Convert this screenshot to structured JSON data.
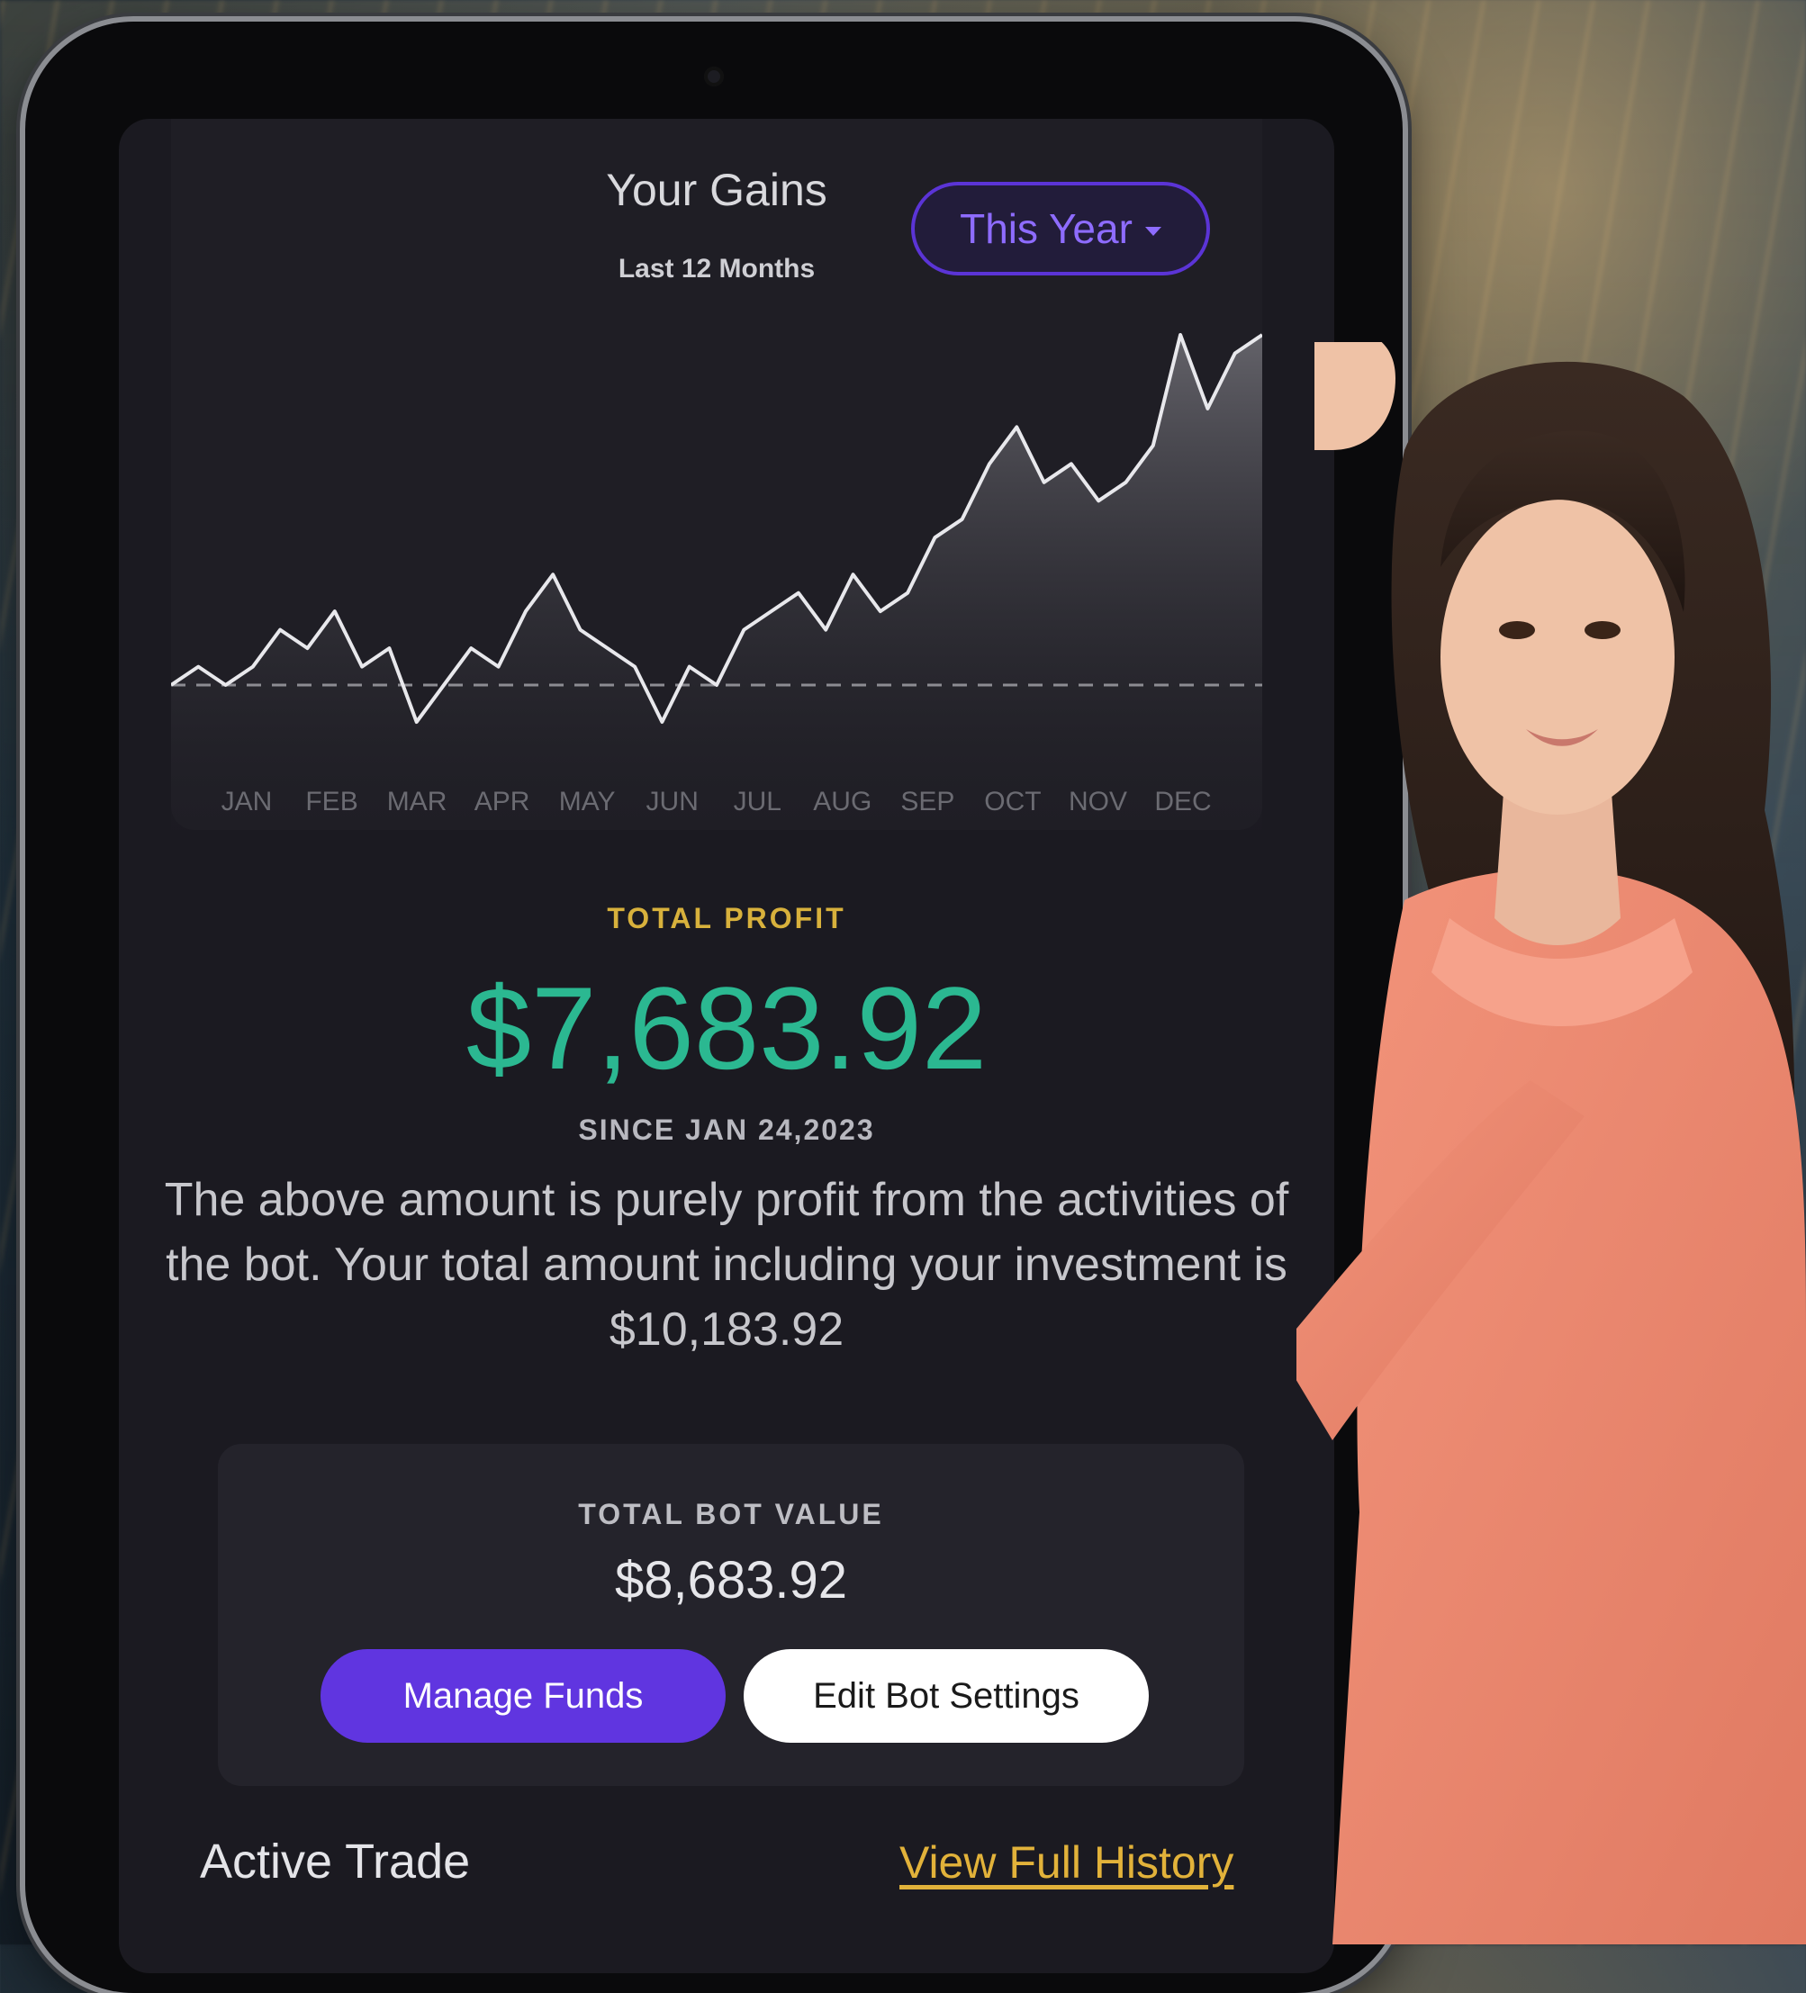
{
  "chart": {
    "title": "Your Gains",
    "subtitle": "Last 12 Months",
    "period_selector": "This Year"
  },
  "chart_data": {
    "type": "area",
    "categories": [
      "JAN",
      "FEB",
      "MAR",
      "APR",
      "MAY",
      "JUN",
      "JUL",
      "AUG",
      "SEP",
      "OCT",
      "NOV",
      "DEC"
    ],
    "x": [
      0,
      0.3,
      0.6,
      0.9,
      1.2,
      1.5,
      1.8,
      2.1,
      2.4,
      2.7,
      3.0,
      3.3,
      3.6,
      3.9,
      4.2,
      4.5,
      4.8,
      5.1,
      5.4,
      5.7,
      6.0,
      6.3,
      6.6,
      6.9,
      7.2,
      7.5,
      7.8,
      8.1,
      8.4,
      8.7,
      9.0,
      9.3,
      9.6,
      9.9,
      10.2,
      10.5,
      10.8,
      11.1,
      11.4,
      11.7,
      12.0
    ],
    "values": [
      0,
      1,
      0,
      1,
      3,
      2,
      4,
      1,
      2,
      -2,
      0,
      2,
      1,
      4,
      6,
      3,
      2,
      1,
      -2,
      1,
      0,
      3,
      4,
      5,
      3,
      6,
      4,
      5,
      8,
      9,
      12,
      14,
      11,
      12,
      10,
      11,
      13,
      19,
      15,
      18,
      19
    ],
    "baseline": 0,
    "grid": false,
    "legend": "none"
  },
  "profit": {
    "label": "TOTAL PROFIT",
    "value": "$7,683.92",
    "since": "SINCE JAN 24,2023",
    "description": "The above amount is purely profit from the activities of the bot. Your total amount including your investment is $10,183.92"
  },
  "bot": {
    "label": "TOTAL BOT VALUE",
    "value": "$8,683.92",
    "manage_button": "Manage Funds",
    "edit_button": "Edit Bot Settings"
  },
  "footer": {
    "active_trade": "Active Trade",
    "view_history": "View Full History"
  },
  "colors": {
    "accent_purple": "#6035e0",
    "profit_green": "#2bb891",
    "gold": "#d8b13c",
    "screen_bg": "#1b1a21"
  }
}
